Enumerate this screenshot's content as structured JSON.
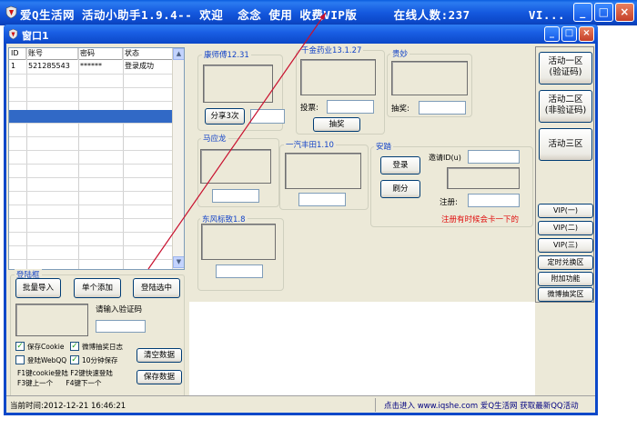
{
  "outer_window": {
    "title": "爱Q生活网 活动小助手1.9.4-- 欢迎  念念 使用 收费VIP版     在线人数:237        VI...",
    "min_label": "_",
    "max_label": "□",
    "close_label": "×"
  },
  "inner_window": {
    "title": "窗口1",
    "min_label": "_",
    "max_label": "□",
    "close_label": "×"
  },
  "account_table": {
    "columns": [
      "ID",
      "账号",
      "密码",
      "状态"
    ],
    "rows": [
      {
        "id": "1",
        "account": "521285543",
        "password": "******",
        "status": "登录成功"
      }
    ]
  },
  "login_box": {
    "legend": "登陆框",
    "batch_import": "批量导入",
    "single_add": "单个添加",
    "login_selected": "登陆选中",
    "captcha_prompt": "请输入验证码",
    "clear_data": "清空数据",
    "save_data": "保存数据",
    "checkboxes": [
      {
        "label": "保存Cookie",
        "checked": true
      },
      {
        "label": "微博抽奖日志",
        "checked": true
      },
      {
        "label": "登陆WebQQ",
        "checked": false
      },
      {
        "label": "10分钟保存",
        "checked": true
      }
    ],
    "hint_line1": "F1键cookie登陆  F2键快速登陆",
    "hint_line2": "F3键上一个      F4键下一个"
  },
  "groups": {
    "kangshi": {
      "legend": "康师傅12.31",
      "share_button": "分享3次"
    },
    "qianjin": {
      "legend": "千金药业13.1.27",
      "vote_label": "投票:",
      "lottery_button": "抽奖"
    },
    "haomiao": {
      "legend": "贵妙",
      "lottery_label": "抽奖:"
    },
    "maying": {
      "legend": "马应龙"
    },
    "yiqi": {
      "legend": "一汽丰田1.10"
    },
    "anzhuang": {
      "legend": "安踏",
      "login_button": "登录",
      "refresh_button": "刷分",
      "invite_label": "邀请ID(u)",
      "register_label": "注册:",
      "register_hint": "注册有时候会卡一下的"
    },
    "dongfeng": {
      "legend": "东风标致1.8"
    }
  },
  "right_panel": {
    "zone1_line1": "活动一区",
    "zone1_line2": "(验证码)",
    "zone2_line1": "活动二区",
    "zone2_line2": "(非验证码)",
    "zone3": "活动三区",
    "vip1": "VIP(一)",
    "vip2": "VIP(二)",
    "vip3": "VIP(三)",
    "timed_exchange": "定时兑换区",
    "extra_functions": "附加功能",
    "weibo_lottery": "微博抽奖区"
  },
  "statusbar": {
    "time": "当前时间:2012-12-21  16:46:21",
    "link": "点击进入  www.iqshe.com  爱Q生活网  获取最新QQ活动"
  },
  "colors": {
    "title_blue": "#0c48c9",
    "face": "#ece9d8",
    "selected_row": "#3169c6",
    "legend_blue": "#1444c8",
    "register_hint_red": "#e01010",
    "annotation_line": "#c8102e"
  }
}
